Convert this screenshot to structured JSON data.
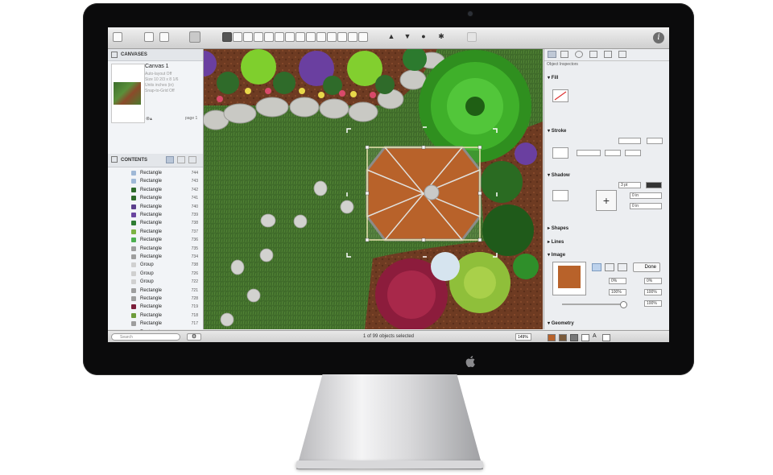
{
  "left_panel": {
    "canvases_title": "CANVASES",
    "canvas_name": "Canvas 1",
    "canvas_meta": [
      "Auto-layout Off",
      "Size 10 2/3 x 8 1/6",
      "Units inches (in)",
      "Snap-to-Grid Off"
    ],
    "page_label": "page 1",
    "contents_title": "CONTENTS",
    "contents": [
      {
        "name": "Rectangle",
        "num": "744",
        "color": "#9fb8d6"
      },
      {
        "name": "Rectangle",
        "num": "743",
        "color": "#9fb8d6"
      },
      {
        "name": "Rectangle",
        "num": "742",
        "color": "#2f6b2a"
      },
      {
        "name": "Rectangle",
        "num": "741",
        "color": "#2f6b2a"
      },
      {
        "name": "Rectangle",
        "num": "740",
        "color": "#5b3e8c"
      },
      {
        "name": "Rectangle",
        "num": "739",
        "color": "#6a45a0"
      },
      {
        "name": "Rectangle",
        "num": "738",
        "color": "#2e7d32"
      },
      {
        "name": "Rectangle",
        "num": "737",
        "color": "#7cb342"
      },
      {
        "name": "Rectangle",
        "num": "736",
        "color": "#4caf50"
      },
      {
        "name": "Rectangle",
        "num": "735",
        "color": "#9e9e9e"
      },
      {
        "name": "Rectangle",
        "num": "734",
        "color": "#9e9e9e"
      },
      {
        "name": "Group",
        "num": "738",
        "color": "#d0d0d0"
      },
      {
        "name": "Group",
        "num": "726",
        "color": "#d0d0d0"
      },
      {
        "name": "Group",
        "num": "722",
        "color": "#d0d0d0"
      },
      {
        "name": "Rectangle",
        "num": "721",
        "color": "#9e9e9e"
      },
      {
        "name": "Rectangle",
        "num": "728",
        "color": "#9e9e9e"
      },
      {
        "name": "Rectangle",
        "num": "719",
        "color": "#7b1e3a"
      },
      {
        "name": "Rectangle",
        "num": "718",
        "color": "#6d9c3b"
      },
      {
        "name": "Rectangle",
        "num": "717",
        "color": "#9e9e9e"
      },
      {
        "name": "Rectangle",
        "num": "",
        "color": "#9e9e9e"
      }
    ]
  },
  "status_bar": {
    "search_placeholder": "Search",
    "selection_text": "1 of 99 objects selected",
    "zoom": "149%"
  },
  "inspector": {
    "title": "Object Inspectors",
    "sections": [
      "Fill",
      "Stroke",
      "Shadow",
      "Shapes",
      "Lines",
      "Image",
      "Geometry"
    ],
    "shadow_width": "3 pt",
    "shadow_x": "0 in",
    "shadow_y": "0 in",
    "image_done": "Done",
    "image_offset_x": "0%",
    "image_offset_y": "0%",
    "image_scale_x": "100%",
    "image_scale_y": "100%",
    "image_opacity": "100%"
  }
}
